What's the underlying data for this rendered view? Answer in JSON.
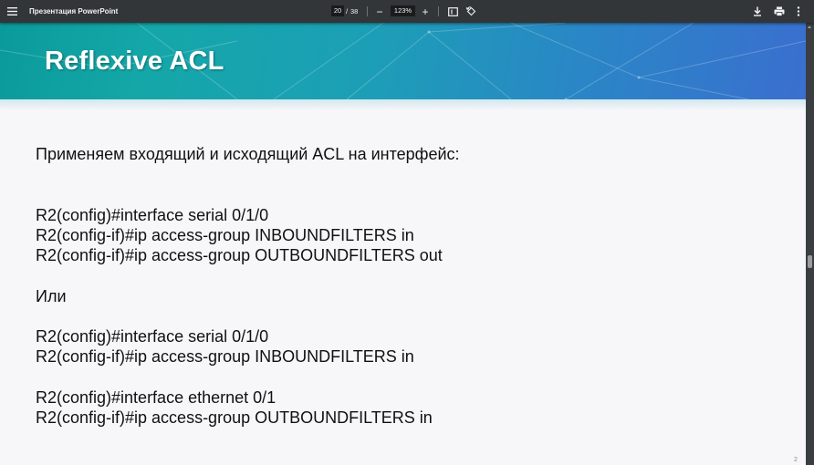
{
  "toolbar": {
    "title": "Презентация PowerPoint",
    "page_current": "20",
    "page_separator": "/",
    "page_total": "38",
    "zoom": "123%",
    "zoom_out_label": "−",
    "zoom_in_label": "+"
  },
  "slide": {
    "title": "Reflexive ACL",
    "lines": [
      "Применяем входящий и исходящий ACL на интерфейс:",
      "R2(config)#interface serial 0/1/0",
      "R2(config-if)#ip access-group INBOUNDFILTERS in",
      "R2(config-if)#ip access-group OUTBOUNDFILTERS out",
      "Или",
      "R2(config)#interface serial 0/1/0",
      "R2(config-if)#ip access-group INBOUNDFILTERS in",
      "R2(config)#interface ethernet 0/1",
      "R2(config-if)#ip access-group OUTBOUNDFILTERS in"
    ],
    "page_number": "2"
  },
  "icons": {
    "menu": "hamburger-icon",
    "fit": "fit-page-icon",
    "rotate": "rotate-icon",
    "download": "download-icon",
    "print": "print-icon",
    "more": "more-vert-icon"
  },
  "colors": {
    "toolbar_bg": "#323639",
    "banner_start": "#0b9a9b",
    "banner_end": "#3a6fcf",
    "slide_bg": "#f7f6f9"
  }
}
